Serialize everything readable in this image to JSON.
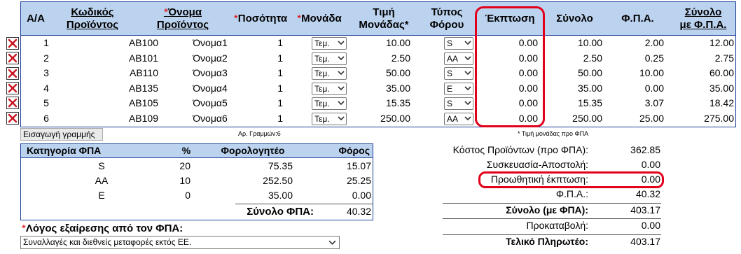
{
  "headers": {
    "aa": "Α/Α",
    "code": [
      "Κωδικός",
      "Προϊόντος"
    ],
    "name_req": "*",
    "name": [
      "Όνομα",
      "Προϊόντος"
    ],
    "qty_req": "*",
    "qty": "Ποσότητα",
    "unit_req": "*",
    "unit": "Μονάδα",
    "price": [
      "Τιμή",
      "Μονάδας*"
    ],
    "taxtype": [
      "Τύπος",
      "Φόρου"
    ],
    "discount": "Έκπτωση",
    "total": "Σύνολο",
    "vat": "Φ.Π.Α.",
    "total_vat": [
      "Σύνολο",
      "με Φ.Π.Α."
    ]
  },
  "rows": [
    {
      "aa": "1",
      "code": "AB100",
      "name": "Όνομα1",
      "qty": "1",
      "unit": "Τεμ.",
      "price": "10.00",
      "tax": "S",
      "discount": "0.00",
      "total": "10.00",
      "vat": "2.00",
      "total_vat": "12.00"
    },
    {
      "aa": "2",
      "code": "AB101",
      "name": "Όνομα2",
      "qty": "1",
      "unit": "Τεμ.",
      "price": "2.50",
      "tax": "AA",
      "discount": "0.00",
      "total": "2.50",
      "vat": "0.25",
      "total_vat": "2.75"
    },
    {
      "aa": "3",
      "code": "AB110",
      "name": "Όνομα3",
      "qty": "1",
      "unit": "Τεμ.",
      "price": "50.00",
      "tax": "S",
      "discount": "0.00",
      "total": "50.00",
      "vat": "10.00",
      "total_vat": "60.00"
    },
    {
      "aa": "4",
      "code": "AB135",
      "name": "Όνομα4",
      "qty": "1",
      "unit": "Τεμ.",
      "price": "35.00",
      "tax": "E",
      "discount": "0.00",
      "total": "35.00",
      "vat": "0.00",
      "total_vat": "35.00"
    },
    {
      "aa": "5",
      "code": "AB105",
      "name": "Όνομα5",
      "qty": "1",
      "unit": "Τεμ.",
      "price": "15.35",
      "tax": "S",
      "discount": "0.00",
      "total": "15.35",
      "vat": "3.07",
      "total_vat": "18.42"
    },
    {
      "aa": "6",
      "code": "AB109",
      "name": "Όνομα6",
      "qty": "1",
      "unit": "Τεμ.",
      "price": "250.00",
      "tax": "AA",
      "discount": "0.00",
      "total": "250.00",
      "vat": "25.00",
      "total_vat": "275.00"
    }
  ],
  "add_line_label": "Εισαγωγή γραμμής",
  "row_count_label": "Αρ. Γραμμών:6",
  "price_note": "* Τιμή μονάδας προ ΦΠΑ",
  "vat_table": {
    "headers": {
      "category": "Κατηγορία ΦΠΑ",
      "pct": "%",
      "taxable": "Φορολογητέο",
      "tax": "Φόρος"
    },
    "rows": [
      {
        "category": "S",
        "pct": "20",
        "taxable": "75.35",
        "tax": "15.07"
      },
      {
        "category": "AA",
        "pct": "10",
        "taxable": "252.50",
        "tax": "25.25"
      },
      {
        "category": "E",
        "pct": "0",
        "taxable": "35.00",
        "tax": "0.00"
      }
    ],
    "total_label": "Σύνολο ΦΠΑ:",
    "total_value": "40.32"
  },
  "exemption": {
    "req": "*",
    "label": "Λόγος εξαίρεσης από τον ΦΠΑ:",
    "selected": "Συναλλαγές και διεθνείς μεταφορές εκτός ΕΕ."
  },
  "totals": [
    {
      "label": "Κόστος Προϊόντων (προ ΦΠΑ):",
      "value": "362.85",
      "bold": false
    },
    {
      "label": "Συσκευασία-Αποστολή:",
      "value": "0.00",
      "bold": false
    },
    {
      "label": "Προωθητική έκπτωση:",
      "value": "0.00",
      "bold": false
    },
    {
      "label": "Φ.Π.Α.:",
      "value": "40.32",
      "bold": false
    },
    {
      "label": "Σύνολο (με ΦΠΑ):",
      "value": "403.17",
      "bold": true
    },
    {
      "label": "Προκαταβολή:",
      "value": "0.00",
      "bold": false
    },
    {
      "label": "Τελικό Πληρωτέο:",
      "value": "403.17",
      "bold": true
    }
  ],
  "colors": {
    "header_bg": "#bcd3ef",
    "border": "#1f3f9a",
    "highlight": "#e2001a",
    "required": "#e00000"
  },
  "icons": {
    "delete": "delete-x-icon",
    "dropdown": "chevron-down-icon"
  }
}
